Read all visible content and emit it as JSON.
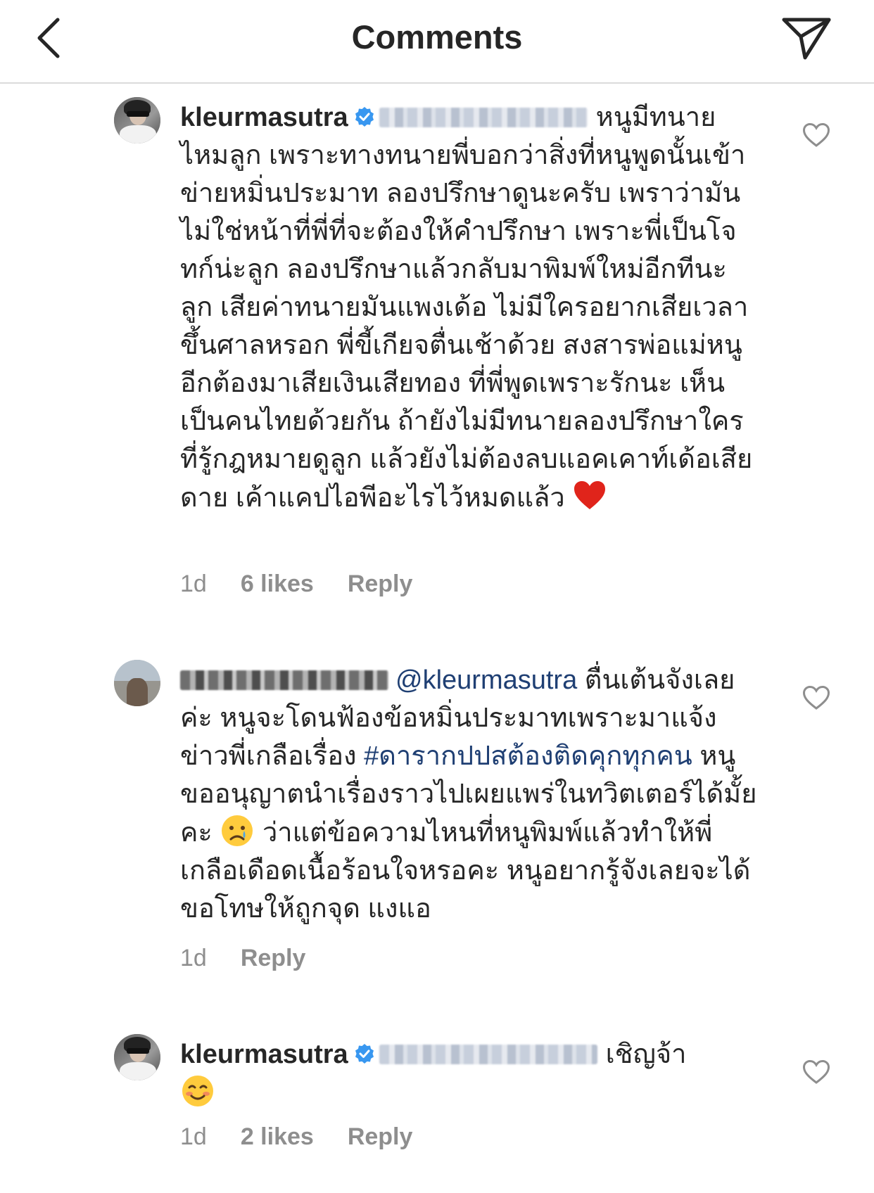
{
  "header": {
    "title": "Comments"
  },
  "comments": [
    {
      "username": "kleurmasutra",
      "verified": true,
      "text_after_mention": "หนูมีทนายไหมลูก เพราะทางทนายพี่บอกว่าสิ่งที่หนูพูดนั้นเข้าข่ายหมิ่นประมาท ลองปรึกษาดูนะครับ เพราว่ามันไม่ใช่หน้าที่พี่ที่จะต้องให้คำปรึกษา เพราะพี่เป็นโจทก์น่ะลูก ลองปรึกษาแล้วกลับมาพิมพ์ใหม่อีกทีนะลูก เสียค่าทนายมันแพงเด้อ ไม่มีใครอยากเสียเวลาขึ้นศาลหรอก พี่ขี้เกียจตื่นเช้าด้วย สงสารพ่อแม่หนูอีกต้องมาเสียเงินเสียทอง ที่พี่พูดเพราะรักนะ เห็นเป็นคนไทยด้วยกัน ถ้ายังไม่มีทนายลองปรึกษาใครที่รู้กฎหมายดูลูก แล้วยังไม่ต้องลบแอคเคาท์เด้อเสียดาย เค้าแคปไอพีอะไรไว้หมดแล้ว",
      "emoji": "red-heart",
      "time": "1d",
      "likes": "6 likes",
      "reply": "Reply"
    },
    {
      "mention": "@kleurmasutra",
      "text_before_hashtag": "ตื่นเต้นจังเลยค่ะ หนูจะโดนฟ้องข้อหมิ่นประมาทเพราะมาแจ้งข่าวพี่เกลือเรื่อง",
      "hashtag": "#ดารากปปสต้องติดคุกทุกคน",
      "text_before_emoji": "หนูขออนุญาตนำเรื่องราวไปเผยแพร่ในทวิตเตอร์ได้มั้ยคะ",
      "text_after_emoji": "ว่าแต่ข้อความไหนที่หนูพิมพ์แล้วทำให้พี่เกลือเดือดเนื้อร้อนใจหรอคะ หนูอยากรู้จังเลยจะได้ขอโทษให้ถูกจุด แงแอ",
      "emoji": "crying-face",
      "time": "1d",
      "reply": "Reply"
    },
    {
      "username": "kleurmasutra",
      "verified": true,
      "text_after_mention": "เชิญจ้า",
      "emoji": "smiling-face",
      "time": "1d",
      "likes": "2 likes",
      "reply": "Reply"
    }
  ],
  "colors": {
    "text": "#262626",
    "secondary": "#8e8e8e",
    "link": "#1f3f73",
    "verified": "#3897f0",
    "divider": "#dbdbdb"
  }
}
